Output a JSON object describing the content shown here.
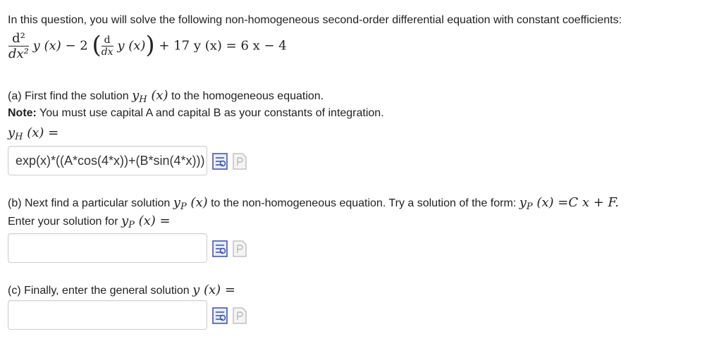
{
  "intro": "In this question, you will solve the following non-homogeneous second-order differential equation with constant coefficients:",
  "equation": {
    "d2_num": "d²",
    "d2_den": "dx²",
    "y_of_x_1": "y (x)",
    "minus_two": "− 2",
    "d_num": "d",
    "d_den": "dx",
    "y_of_x_2": "y (x)",
    "plus_term": "+ 17 y (x) = 6 x − 4"
  },
  "part_a": {
    "prompt": "(a) First find the solution",
    "prompt_after": "to the homogeneous equation.",
    "note_label": "Note:",
    "note_text": " You must use capital A and capital B as your constants of integration.",
    "lhs_symbol": "y",
    "lhs_sub": "H",
    "lhs_arg": " (x) =",
    "answer_value": "exp(x)*((A*cos(4*x))+(B*sin(4*x)))"
  },
  "part_b": {
    "prompt": "(b) Next find a particular solution",
    "prompt_mid": "to the non-homogeneous equation. Try a solution of the form:",
    "form_rhs": " (x) =C x + F.",
    "enter_text": "Enter your solution for",
    "symbol": "y",
    "sub": "P",
    "arg": " (x)",
    "arg_eq": " (x) =",
    "answer_value": ""
  },
  "part_c": {
    "prompt": "(c) Finally, enter the general solution",
    "lhs": "y (x) =",
    "answer_value": ""
  },
  "icons": [
    "equation-editor-icon",
    "preview-icon"
  ],
  "colors": {
    "text": "#222222",
    "field_border": "#cfcfcf",
    "icon_blue": "#3b4fa0",
    "icon_grey": "#b8b8b8"
  }
}
